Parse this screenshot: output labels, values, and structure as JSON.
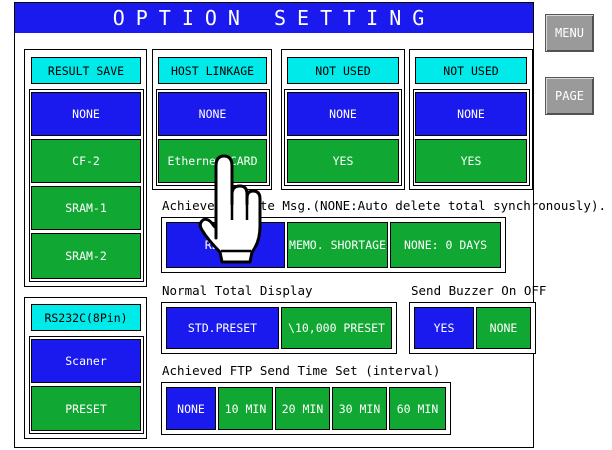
{
  "title": "OPTION SETTING",
  "side": {
    "menu": "MENU",
    "page": "PAGE"
  },
  "columns": [
    {
      "header": "RESULT SAVE",
      "options": [
        "NONE",
        "CF-2",
        "SRAM-1",
        "SRAM-2"
      ]
    },
    {
      "header": "HOST LINKAGE",
      "options": [
        "NONE",
        "Ethernet CARD"
      ]
    },
    {
      "header": "NOT USED",
      "options": [
        "NONE",
        "YES"
      ]
    },
    {
      "header": "NOT USED",
      "options": [
        "NONE",
        "YES"
      ]
    }
  ],
  "rs232c": {
    "header": "RS232C(8Pin)",
    "options": [
      "Scaner",
      "PRESET"
    ]
  },
  "achieved_msg": {
    "label": "Achieved Delete Msg.(NONE:Auto delete total synchronously).",
    "options": [
      "RESULT",
      "MEMO. SHORTAGE",
      "NONE:  0 DAYS"
    ]
  },
  "normal_total": {
    "label": "Normal Total Display",
    "options": [
      "STD.PRESET",
      "\\10,000 PRESET"
    ]
  },
  "send_buzzer": {
    "label": "Send Buzzer On OFF",
    "options": [
      "YES",
      "NONE"
    ]
  },
  "ftp_send": {
    "label": "Achieved FTP Send Time Set (interval)",
    "options": [
      "NONE",
      "10 MIN",
      "20 MIN",
      "30 MIN",
      "60 MIN"
    ]
  },
  "colors": {
    "selected": "#1a1aee",
    "option": "#10a833",
    "header": "#00eaea",
    "side_button": "#9a9a9a"
  },
  "overlay_icon": "pointing-hand-icon"
}
